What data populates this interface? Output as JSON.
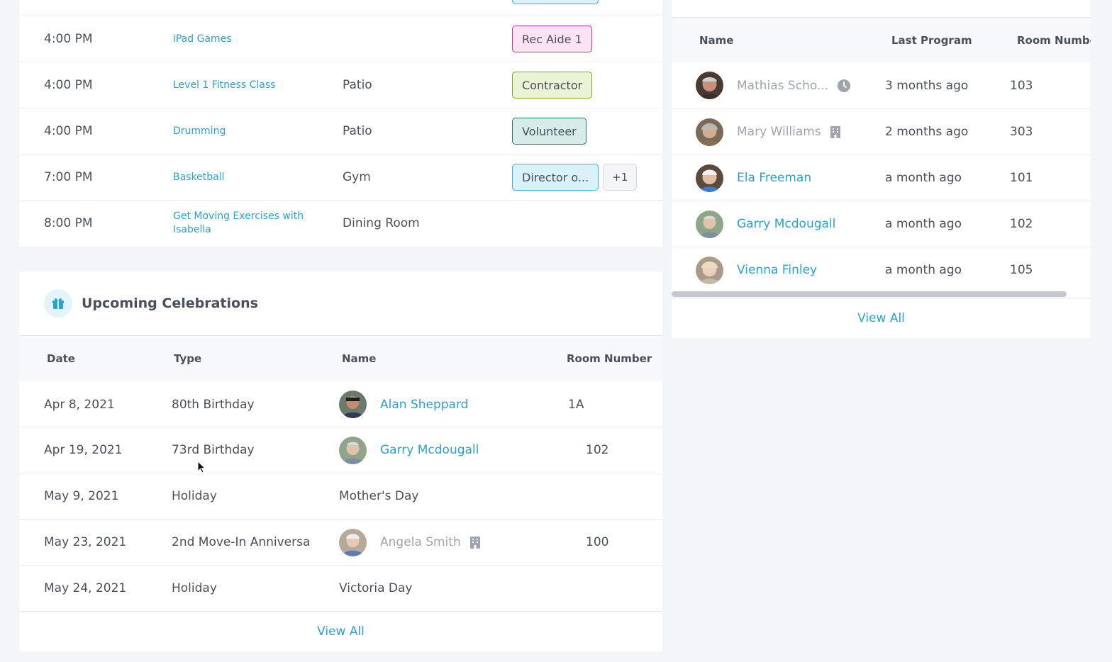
{
  "programs": {
    "rows": [
      {
        "time": "4:00 PM",
        "name": "iPad Games",
        "location": "",
        "tag": "Rec Aide 1",
        "extra": ""
      },
      {
        "time": "4:00 PM",
        "name": "Level 1 Fitness Class",
        "location": "Patio",
        "tag": "Contractor",
        "extra": ""
      },
      {
        "time": "4:00 PM",
        "name": "Drumming",
        "location": "Patio",
        "tag": "Volunteer",
        "extra": ""
      },
      {
        "time": "7:00 PM",
        "name": "Basketball",
        "location": "Gym",
        "tag": "Director o...",
        "extra": "+1"
      },
      {
        "time": "8:00 PM",
        "name": "Get Moving Exercises with Isabella",
        "location": "Dining Room",
        "tag": "",
        "extra": ""
      }
    ]
  },
  "celebrations": {
    "title": "Upcoming Celebrations",
    "icon": "gift-icon",
    "headers": {
      "date": "Date",
      "type": "Type",
      "name": "Name",
      "room": "Room Number"
    },
    "rows": [
      {
        "date": "Apr 8, 2021",
        "type": "80th Birthday",
        "name": "Alan Sheppard",
        "room": "1A"
      },
      {
        "date": "Apr 19, 2021",
        "type": "73rd Birthday",
        "name": "Garry Mcdougall",
        "room": "102"
      },
      {
        "date": "May 9, 2021",
        "type": "Holiday",
        "name": "Mother's Day",
        "room": ""
      },
      {
        "date": "May 23, 2021",
        "type": "2nd Move-In Anniversa",
        "name": "Angela Smith",
        "room": "100"
      },
      {
        "date": "May 24, 2021",
        "type": "Holiday",
        "name": "Victoria Day",
        "room": ""
      }
    ],
    "view_all": "View All"
  },
  "residents": {
    "headers": {
      "name": "Name",
      "last_program": "Last Program",
      "room": "Room Number"
    },
    "rows": [
      {
        "name": "Mathias Scho...",
        "last_program": "3 months ago",
        "room": "103",
        "status_icon": "clock-icon"
      },
      {
        "name": "Mary Williams",
        "last_program": "2 months ago",
        "room": "303",
        "status_icon": "building-icon"
      },
      {
        "name": "Ela Freeman",
        "last_program": "a month ago",
        "room": "101",
        "status_icon": ""
      },
      {
        "name": "Garry Mcdougall",
        "last_program": "a month ago",
        "room": "102",
        "status_icon": ""
      },
      {
        "name": "Vienna Finley",
        "last_program": "a month ago",
        "room": "105",
        "status_icon": ""
      }
    ],
    "view_all": "View All"
  },
  "colors": {
    "link": "#2aa2cd",
    "muted": "#a0a4ae",
    "background": "#f4f5f8",
    "tag_pink": "#fbe3f3",
    "tag_green": "#eaf3d4",
    "tag_teal": "#d7ebe9",
    "tag_blue": "#d9f1fb"
  }
}
